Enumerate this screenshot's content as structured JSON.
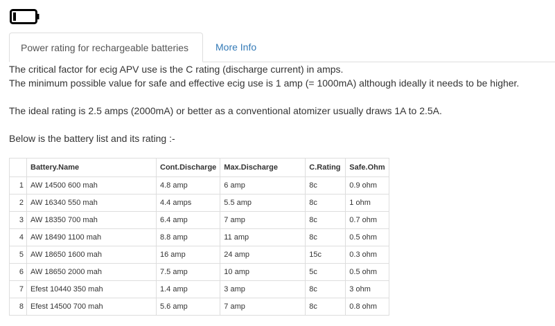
{
  "icons": {
    "battery": "battery-empty-icon"
  },
  "tabs": [
    {
      "label": "Power rating for rechargeable batteries",
      "active": true
    },
    {
      "label": "More Info",
      "active": false
    }
  ],
  "intro": {
    "line1": "The critical factor for ecig APV use is the C rating (discharge current) in amps.",
    "line2": "The minimum possible value for safe and effective ecig use is 1 amp (= 1000mA) although ideally it needs to be higher.",
    "line3": "The ideal rating is 2.5 amps (2000mA) or better as a conventional atomizer usually draws 1A to 2.5A.",
    "line4": "Below is the battery list and its rating :-"
  },
  "table": {
    "headers": [
      "",
      "Battery.Name",
      "Cont.Discharge",
      "Max.Discharge",
      "C.Rating",
      "Safe.Ohm"
    ],
    "rows": [
      [
        "1",
        "AW 14500 600 mah",
        "4.8 amp",
        "6 amp",
        "8c",
        "0.9 ohm"
      ],
      [
        "2",
        "AW 16340 550 mah",
        "4.4 amps",
        "5.5 amp",
        "8c",
        "1 ohm"
      ],
      [
        "3",
        "AW 18350 700 mah",
        "6.4 amp",
        "7 amp",
        "8c",
        "0.7 ohm"
      ],
      [
        "4",
        "AW 18490 1100 mah",
        "8.8 amp",
        "11 amp",
        "8c",
        "0.5 ohm"
      ],
      [
        "5",
        "AW 18650 1600 mah",
        "16 amp",
        "24 amp",
        "15c",
        "0.3 ohm"
      ],
      [
        "6",
        "AW 18650 2000 mah",
        "7.5 amp",
        "10 amp",
        "5c",
        "0.5 ohm"
      ],
      [
        "7",
        "Efest 10440 350 mah",
        "1.4 amp",
        "3 amp",
        "8c",
        "3 ohm"
      ],
      [
        "8",
        "Efest 14500 700 mah",
        "5.6 amp",
        "7 amp",
        "8c",
        "0.8 ohm"
      ]
    ]
  }
}
